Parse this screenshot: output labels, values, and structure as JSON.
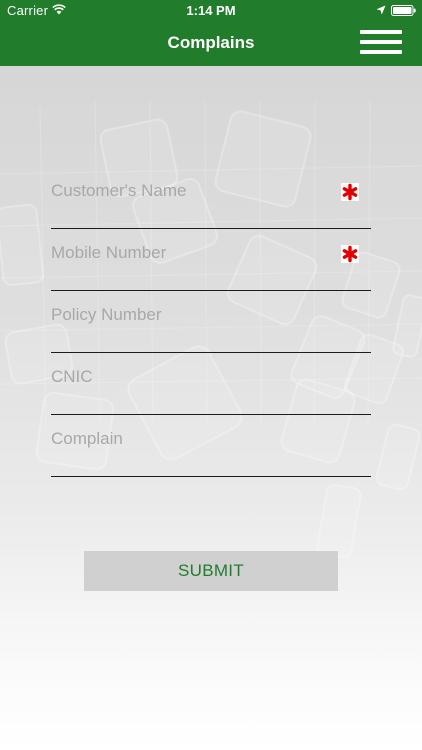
{
  "status_bar": {
    "carrier": "Carrier",
    "time": "1:14 PM",
    "icons": [
      "wifi-icon",
      "location-icon",
      "battery-icon"
    ]
  },
  "nav": {
    "title": "Complains",
    "menu_icon": "hamburger-menu-icon"
  },
  "form": {
    "fields": [
      {
        "placeholder": "Customer's Name",
        "value": "",
        "required": true
      },
      {
        "placeholder": "Mobile Number",
        "value": "",
        "required": true
      },
      {
        "placeholder": "Policy Number",
        "value": "",
        "required": false
      },
      {
        "placeholder": "CNIC",
        "value": "",
        "required": false
      },
      {
        "placeholder": "Complain",
        "value": "",
        "required": false
      }
    ],
    "submit_label": "SUBMIT"
  },
  "colors": {
    "brand_green": "#217c2b",
    "required_red": "#e30000",
    "button_bg": "#d0d0d0"
  }
}
